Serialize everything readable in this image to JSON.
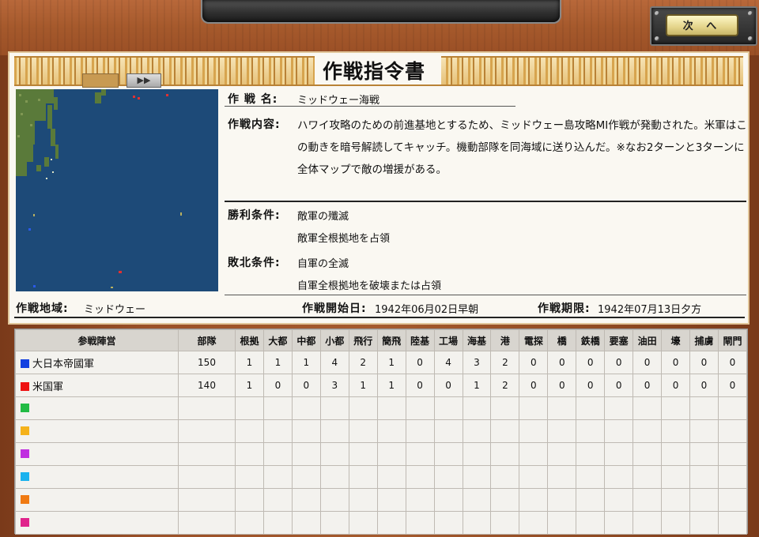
{
  "header": {
    "next_label": "次 へ"
  },
  "doc": {
    "title": "作戦指令書",
    "fast_forward": "▶▶",
    "op_name_label": "作 戦 名:",
    "op_name": "ミッドウェー海戦",
    "op_content_label": "作戦内容:",
    "op_content": "ハワイ攻略のための前進基地とするため、ミッドウェー島攻略MI作戦が発動された。米軍はこの動きを暗号解読してキャッチ。機動部隊を同海域に送り込んだ。※なお2ターンと3ターンに全体マップで敵の増援がある。",
    "victory_label": "勝利条件:",
    "victory_1": "敵軍の殲滅",
    "victory_2": "敵軍全根拠地を占領",
    "defeat_label": "敗北条件:",
    "defeat_1": "自軍の全滅",
    "defeat_2": "自軍全根拠地を破壊または占領",
    "area_label": "作戦地域:",
    "area": "ミッドウェー",
    "start_label": "作戦開始日:",
    "start": "1942年06月02日早朝",
    "end_label": "作戦期限:",
    "end": "1942年07月13日夕方"
  },
  "table": {
    "headers": [
      "参戦陣営",
      "部隊",
      "根拠",
      "大都",
      "中都",
      "小都",
      "飛行",
      "簡飛",
      "陸基",
      "工場",
      "海基",
      "港",
      "電探",
      "橋",
      "鉄橋",
      "要塞",
      "油田",
      "壕",
      "捕虜",
      "閘門"
    ],
    "rows": [
      {
        "name": "大日本帝國軍",
        "color": "#1340e0",
        "values": [
          150,
          1,
          1,
          1,
          4,
          2,
          1,
          0,
          4,
          3,
          2,
          0,
          0,
          0,
          0,
          0,
          0,
          0,
          0
        ]
      },
      {
        "name": "米国軍",
        "color": "#ee1111",
        "values": [
          140,
          1,
          0,
          0,
          3,
          1,
          1,
          0,
          0,
          1,
          2,
          0,
          0,
          0,
          0,
          0,
          0,
          0,
          0
        ]
      },
      {
        "name": "",
        "color": "#22bb44",
        "values": []
      },
      {
        "name": "",
        "color": "#f5b21a",
        "values": []
      },
      {
        "name": "",
        "color": "#c02ee0",
        "values": []
      },
      {
        "name": "",
        "color": "#1ab2ee",
        "values": []
      },
      {
        "name": "",
        "color": "#f07a12",
        "values": []
      },
      {
        "name": "",
        "color": "#e0248c",
        "values": []
      }
    ]
  }
}
